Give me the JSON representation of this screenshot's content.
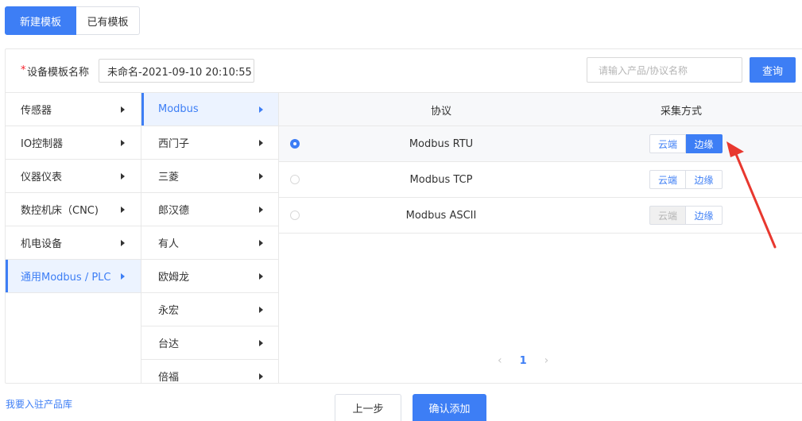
{
  "mode_tabs": {
    "new_label": "新建模板",
    "existing_label": "已有模板"
  },
  "form": {
    "required_mark": "*",
    "name_label": "设备模板名称",
    "name_value": "未命名-2021-09-10 20:10:55",
    "search_placeholder": "请输入产品/协议名称",
    "search_button": "查询"
  },
  "categories": [
    {
      "label": "传感器",
      "active": false
    },
    {
      "label": "IO控制器",
      "active": false
    },
    {
      "label": "仪器仪表",
      "active": false
    },
    {
      "label": "数控机床（CNC)",
      "active": false
    },
    {
      "label": "机电设备",
      "active": false
    },
    {
      "label": "通用Modbus / PLC",
      "active": true
    }
  ],
  "vendors": [
    {
      "label": "Modbus",
      "active": true
    },
    {
      "label": "西门子",
      "active": false
    },
    {
      "label": "三菱",
      "active": false
    },
    {
      "label": "郎汉德",
      "active": false
    },
    {
      "label": "有人",
      "active": false
    },
    {
      "label": "欧姆龙",
      "active": false
    },
    {
      "label": "永宏",
      "active": false
    },
    {
      "label": "台达",
      "active": false
    },
    {
      "label": "倍福",
      "active": false
    }
  ],
  "table": {
    "col_protocol": "协议",
    "col_mode": "采集方式",
    "rows": [
      {
        "name": "Modbus RTU",
        "selected": true,
        "cloud": "云端",
        "edge": "边缘",
        "active_mode": "edge",
        "cloud_disabled": false
      },
      {
        "name": "Modbus TCP",
        "selected": false,
        "cloud": "云端",
        "edge": "边缘",
        "active_mode": "none",
        "cloud_disabled": false
      },
      {
        "name": "Modbus ASCII",
        "selected": false,
        "cloud": "云端",
        "edge": "边缘",
        "active_mode": "none",
        "cloud_disabled": true
      }
    ]
  },
  "pagination": {
    "prev": "‹",
    "current": "1",
    "next": "›"
  },
  "footer": {
    "join_link": "我要入驻产品库",
    "prev_button": "上一步",
    "confirm_button": "确认添加"
  },
  "colors": {
    "primary": "#3d7ef5",
    "annotation_arrow": "#e8382f"
  }
}
